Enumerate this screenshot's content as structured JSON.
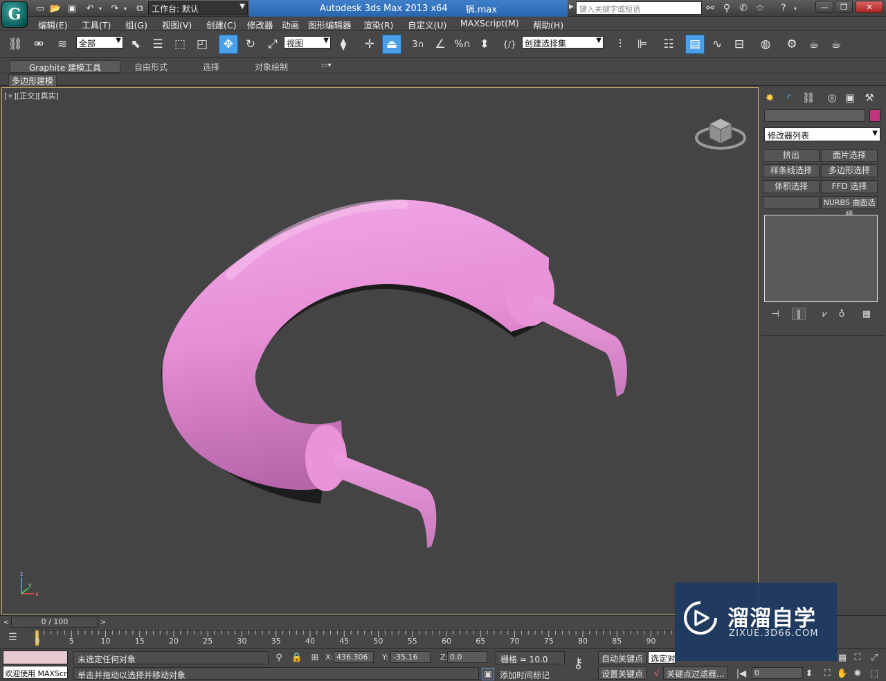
{
  "titlebar": {
    "workspace_label": "工作台: 默认",
    "app_title": "Autodesk 3ds Max  2013 x64",
    "filename": "锅.max",
    "search_placeholder": "键入关键字或短语"
  },
  "menu": [
    "编辑(E)",
    "工具(T)",
    "组(G)",
    "视图(V)",
    "创建(C)",
    "修改器",
    "动画",
    "图形编辑器",
    "渲染(R)",
    "自定义(U)",
    "MAXScript(M)",
    "帮助(H)"
  ],
  "toolbar": {
    "selection_filter": "全部",
    "reference_coord": "视图",
    "snap_toggle": "3",
    "named_selection_set": "创建选择集"
  },
  "ribbon": {
    "tabs": [
      "Graphite 建模工具",
      "自由形式",
      "选择",
      "对象绘制"
    ],
    "sub_label": "多边形建模"
  },
  "viewport": {
    "label": "[+][正交][真实]",
    "object_color": "#e68ed6"
  },
  "command_panel": {
    "modifier_list": "修改器列表",
    "object_color": "#c2357c",
    "modifier_buttons": [
      "挤出",
      "面片选择",
      "样条线选择",
      "多边形选择",
      "体积选择",
      "FFD 选择",
      "",
      "NURBS 曲面选择"
    ]
  },
  "timeline": {
    "frame_display": "0 / 100",
    "ticks": [
      "0",
      "5",
      "10",
      "15",
      "20",
      "25",
      "30",
      "35",
      "40",
      "45",
      "50",
      "55",
      "60",
      "65",
      "70",
      "75",
      "80",
      "85",
      "90"
    ]
  },
  "status": {
    "maxscript_welcome": "欢迎使用 MAXScri",
    "selection_status": "未选定任何对象",
    "prompt": "单击并拖动以选择并移动对象",
    "x_label": "X:",
    "x_value": "436.306",
    "y_label": "Y:",
    "y_value": "-35.16",
    "z_label": "Z:",
    "z_value": "0.0",
    "grid": "栅格 = 10.0",
    "add_time_tag": "添加时间标记",
    "auto_key": "自动关键点",
    "selected_object_dd": "选定对",
    "set_key": "设置关键点",
    "key_filters": "关键点过滤器...",
    "current_frame": "0"
  },
  "watermark": {
    "title": "溜溜自学",
    "url": "ZIXUE.3D66.COM"
  }
}
